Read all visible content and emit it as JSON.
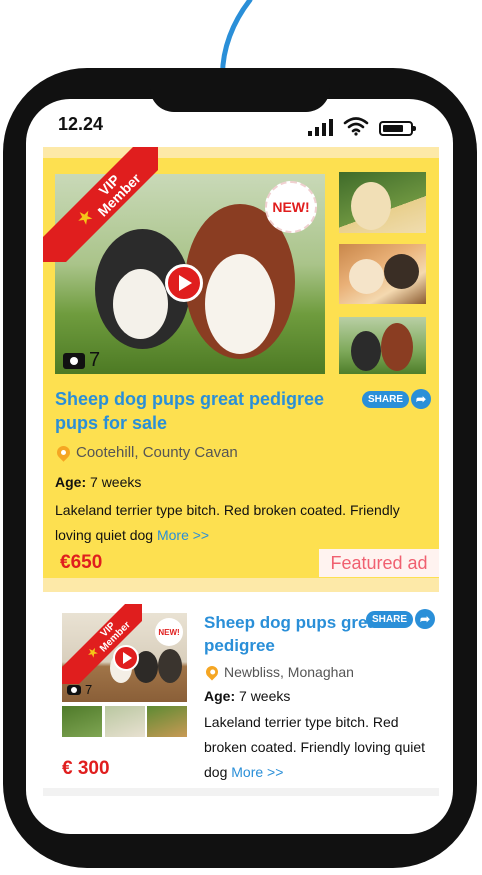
{
  "status_bar": {
    "time": "12.24"
  },
  "listings": [
    {
      "badge": "VIP Member",
      "new_label": "NEW!",
      "photo_count": "7",
      "title": "Sheep dog pups great pedigree pups for sale",
      "share_label": "SHARE",
      "location": "Cootehill, County Cavan",
      "age_label": "Age:",
      "age_value": "7 weeks",
      "description": "Lakeland terrier type bitch. Red broken coated. Friendly loving quiet dog",
      "more_label": "More >>",
      "price": "€650",
      "featured_label": "Featured ad"
    },
    {
      "badge": "VIP Member",
      "new_label": "NEW!",
      "photo_count": "7",
      "title": "Sheep dog pups great pedigree",
      "share_label": "SHARE",
      "location": "Newbliss, Monaghan",
      "age_label": "Age:",
      "age_value": "7 weeks",
      "description": "Lakeland terrier type bitch. Red broken coated. Friendly loving quiet dog",
      "more_label": "More >>",
      "price": "€ 300"
    }
  ],
  "colors": {
    "accent": "#2a8fd8",
    "featured_bg": "#fde050",
    "price": "#e01e1e",
    "ribbon": "#e01e1e",
    "pin": "#f5a623"
  },
  "icons": [
    "curved-arrow-icon",
    "signal-icon",
    "wifi-icon",
    "battery-icon",
    "play-icon",
    "camera-icon",
    "location-pin-icon",
    "share-arrow-icon",
    "star-icon"
  ]
}
